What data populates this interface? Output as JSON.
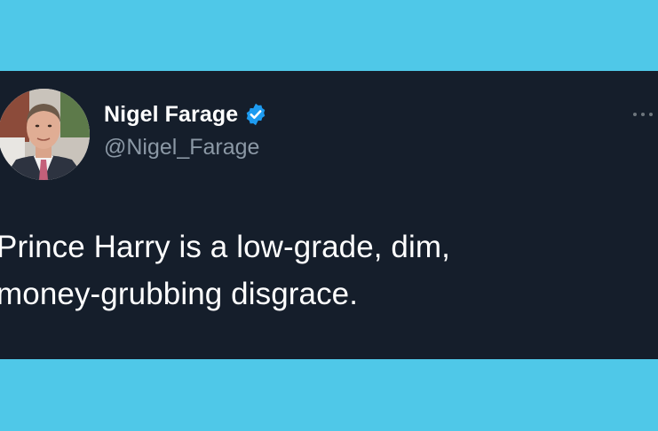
{
  "tweet": {
    "display_name": "Nigel Farage",
    "handle": "@Nigel_Farage",
    "text": "Prince Harry is a low-grade, dim,\nmoney-grubbing disgrace.",
    "verified": true
  },
  "icons": {
    "verified": "verified-badge-icon",
    "more": "more-options-icon",
    "avatar": "profile-photo"
  },
  "colors": {
    "page_background": "#4fc8e8",
    "card_background": "#151e2b",
    "verified_blue": "#1d9bf0",
    "handle_gray": "#8b98a5"
  }
}
